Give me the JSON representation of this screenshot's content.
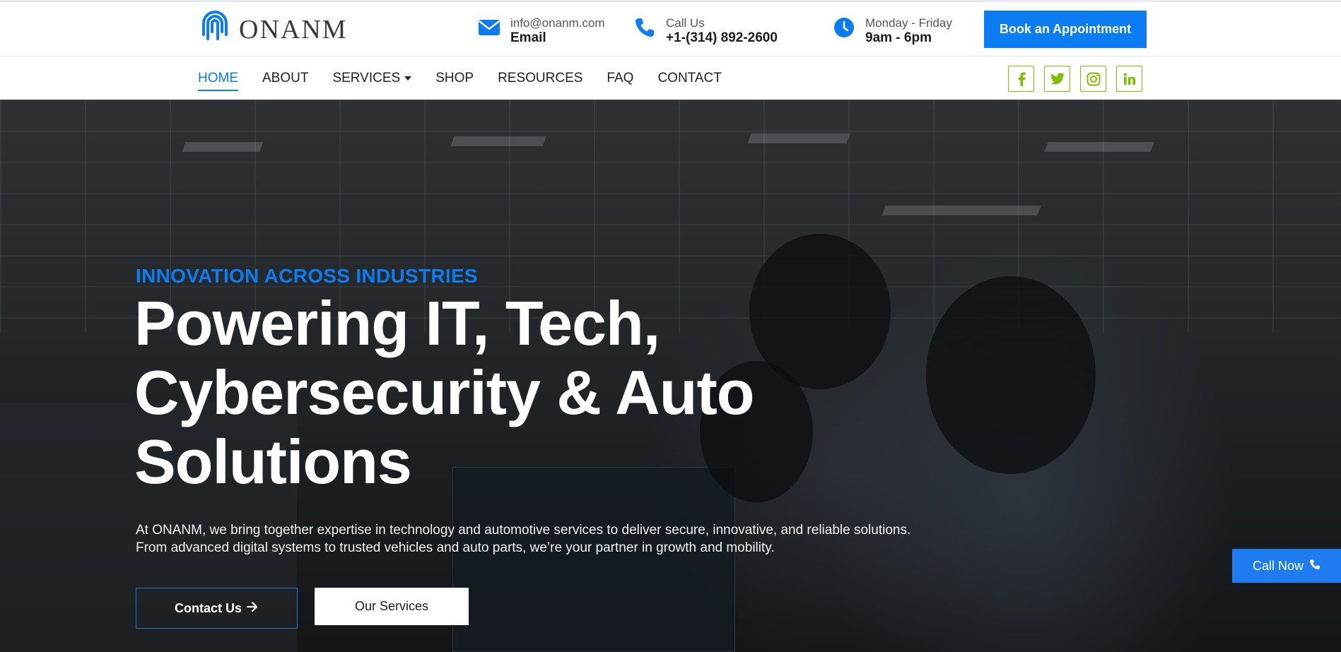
{
  "brand": {
    "logo_text": "ONANM",
    "logo_icon": "onanm-logo-icon"
  },
  "contact": {
    "email": {
      "value": "info@onanm.com",
      "label": "Email",
      "icon": "envelope-icon"
    },
    "phone": {
      "label": "Call Us",
      "value": "+1-(314) 892-2600",
      "icon": "phone-icon"
    },
    "hours": {
      "days": "Monday - Friday",
      "time": "9am - 6pm",
      "icon": "clock-icon"
    }
  },
  "header": {
    "book_label": "Book an Appointment"
  },
  "nav": {
    "items": [
      {
        "label": "HOME",
        "active": true
      },
      {
        "label": "ABOUT"
      },
      {
        "label": "SERVICES",
        "has_dropdown": true
      },
      {
        "label": "SHOP"
      },
      {
        "label": "RESOURCES"
      },
      {
        "label": "FAQ"
      },
      {
        "label": "CONTACT"
      }
    ]
  },
  "socials": [
    "facebook-icon",
    "twitter-icon",
    "instagram-icon",
    "linkedin-icon"
  ],
  "colors": {
    "accent": "#0b7cf2",
    "social": "#7cc000",
    "hero_bg": "#25292c"
  },
  "hero": {
    "eyebrow": "INNOVATION ACROSS INDUSTRIES",
    "headline": "Powering IT, Tech, Cybersecurity & Auto Solutions",
    "lead": "At ONANM, we bring together expertise in technology and automotive services to deliver secure, innovative, and reliable solutions. From advanced digital systems to trusted vehicles and auto parts, we’re your partner in growth and mobility.",
    "cta_primary": "Contact Us",
    "cta_secondary": "Our Services"
  },
  "floating": {
    "call_label": "Call Now"
  }
}
